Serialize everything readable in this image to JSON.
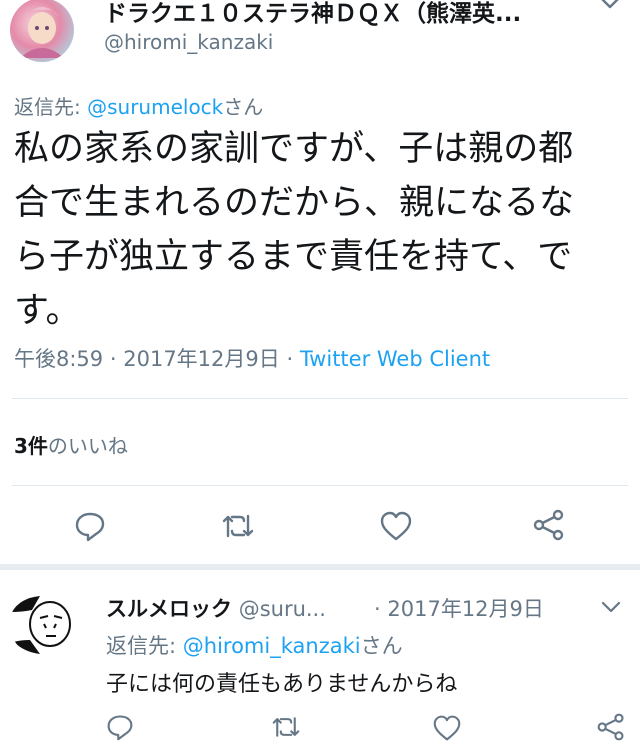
{
  "main_tweet": {
    "author_name": "ドラクエ１０ステラ神ＤＱＸ（熊澤英...",
    "author_handle": "@hiromi_kanzaki",
    "reply_to_prefix": "返信先: ",
    "reply_to_handle": "@surumelock",
    "reply_to_suffix": "さん",
    "text_lines": [
      "私の家系の家訓ですが、子は親の都",
      "合で生まれるのだから、親になるな",
      "ら子が独立するまで責任を持て、で",
      "す。"
    ],
    "time": "午後8:59",
    "date": "2017年12月9日",
    "separator": "·",
    "client": "Twitter Web Client",
    "likes_count": "3件",
    "likes_label": "のいいね"
  },
  "reply_tweet": {
    "author_name": "スルメロック",
    "author_handle": "@suru...",
    "separator": "·",
    "date": "2017年12月9日",
    "reply_to_prefix": "返信先: ",
    "reply_to_handle": "@hiromi_kanzaki",
    "reply_to_suffix": "さん",
    "text": "子には何の責任もありませんからね"
  },
  "colors": {
    "accent": "#1da1f2",
    "secondary_text": "#657786",
    "divider": "#e1e8ed",
    "icon": "#657786"
  }
}
